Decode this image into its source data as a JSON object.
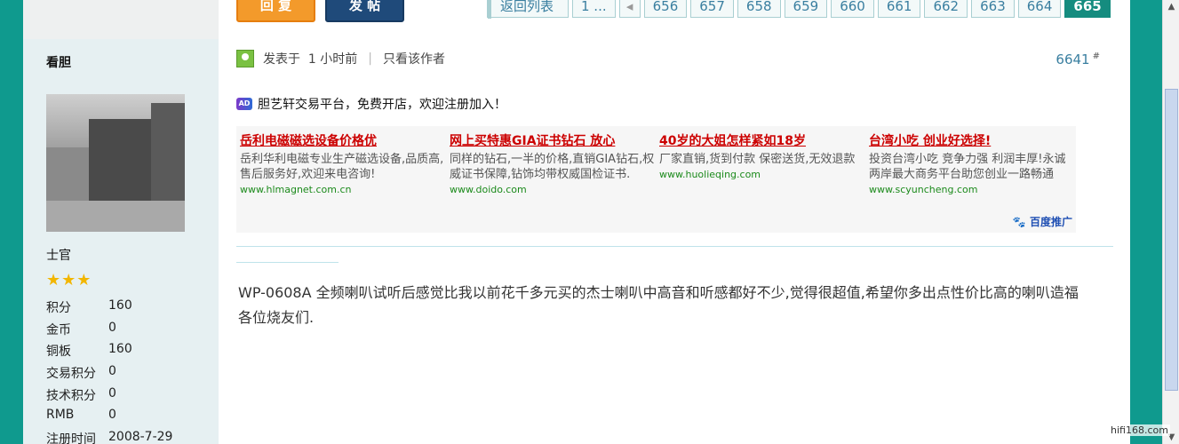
{
  "toolbar": {
    "reply_label": "回 复",
    "post_label": "发 帖"
  },
  "pager": {
    "back_label": "返回列表",
    "first_label": "1 ...",
    "pages": [
      "656",
      "657",
      "658",
      "659",
      "660",
      "661",
      "662",
      "663",
      "664"
    ],
    "current": "665"
  },
  "author": {
    "name": "看胆",
    "rank": "士官",
    "stars": "★★★",
    "stats": [
      {
        "label": "积分",
        "value": "160"
      },
      {
        "label": "金币",
        "value": "0"
      },
      {
        "label": "铜板",
        "value": "160"
      },
      {
        "label": "交易积分",
        "value": "0"
      },
      {
        "label": "技术积分",
        "value": "0"
      },
      {
        "label": "RMB",
        "value": "0"
      },
      {
        "label": "注册时间",
        "value": "2008-7-29"
      }
    ]
  },
  "post": {
    "posted_prefix": "发表于",
    "posted_time": "1 小时前",
    "only_author": "只看该作者",
    "floor": "6641",
    "floor_sup": "#",
    "notice_badge": "AD",
    "notice": "胆艺轩交易平台，免费开店，欢迎注册加入！",
    "content": "WP-0608A 全频喇叭试听后感觉比我以前花千多元买的杰士喇叭中高音和听感都好不少,觉得很超值,希望你多出点性价比高的喇叭造福各位烧友们."
  },
  "ads": [
    {
      "title": "岳利电磁磁选设备价格优",
      "desc": "岳利华利电磁专业生产磁选设备,品质高,售后服务好,欢迎来电咨询!",
      "url": "www.hlmagnet.com.cn"
    },
    {
      "title": "网上买特惠GIA证书钻石 放心",
      "desc": "同样的钻石,一半的价格,直销GIA钻石,权威证书保障,钻饰均带权威国检证书.",
      "url": "www.doido.com"
    },
    {
      "title": "40岁的大姐怎样紧如18岁",
      "desc": "厂家直销,货到付款 保密送货,无效退款",
      "url": "www.huolieqing.com"
    },
    {
      "title": "台湾小吃 创业好选择!",
      "desc": "投资台湾小吃 竞争力强 利润丰厚!永诚两岸最大商务平台助您创业一路畅通",
      "url": "www.scyuncheng.com"
    }
  ],
  "baidu_label": "百度推广",
  "watermark": "hifi168.com",
  "colors": {
    "accent_teal": "#0f9a8e",
    "reply_orange": "#f39a2b",
    "post_navy": "#1f4a7a",
    "ad_red": "#cc0000",
    "link_blue": "#3a7fa0"
  }
}
